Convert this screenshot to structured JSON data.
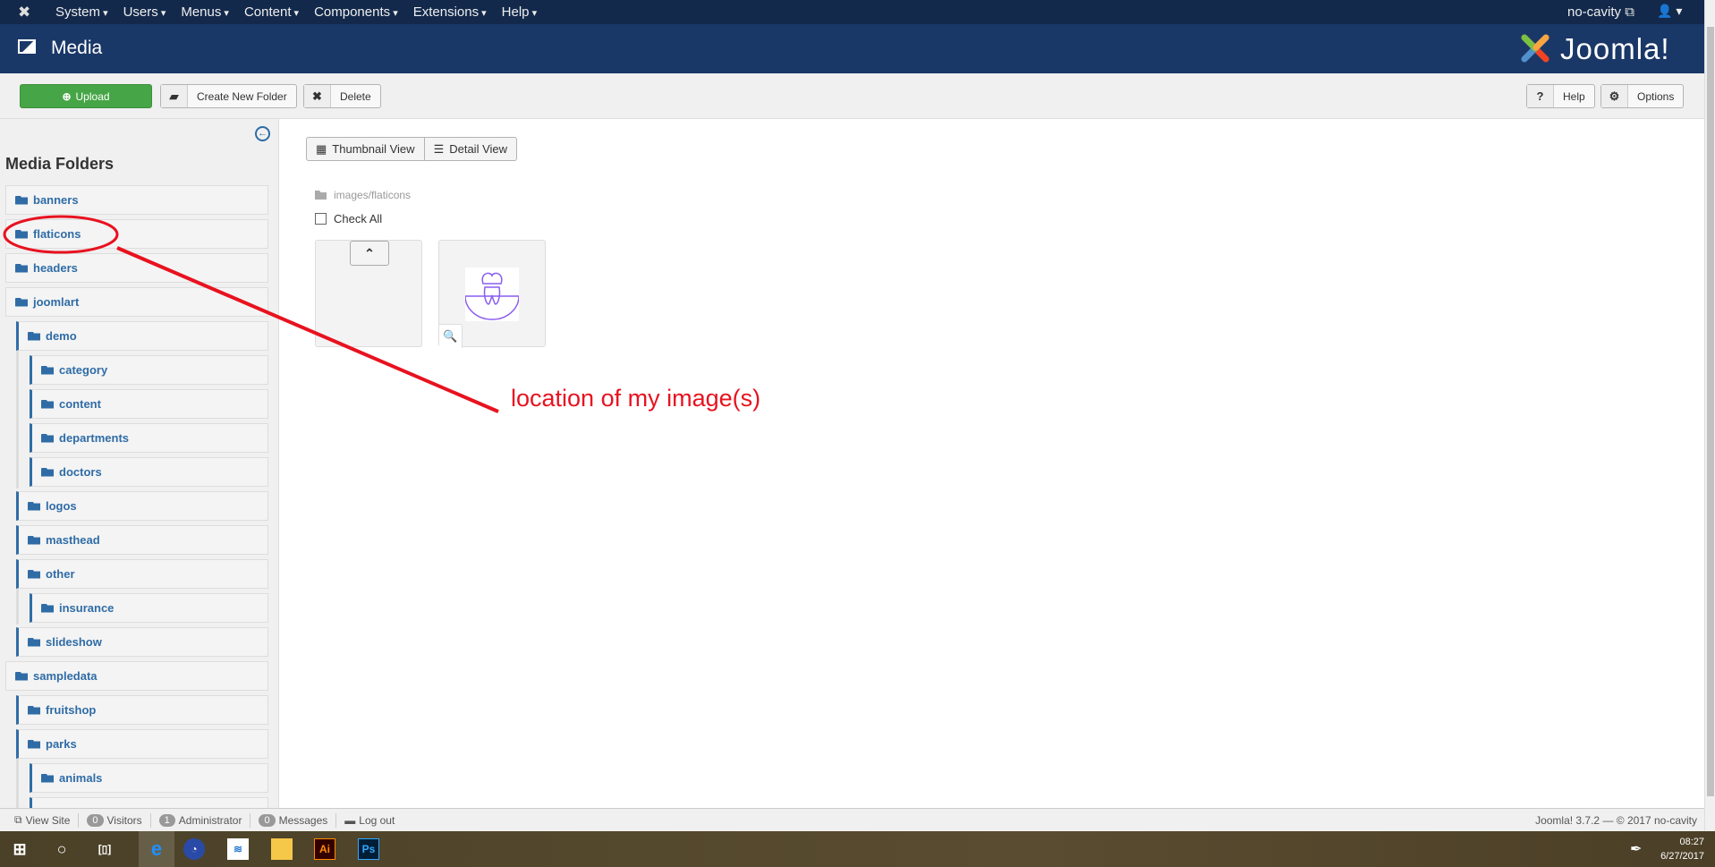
{
  "nav": {
    "menus": [
      "System",
      "Users",
      "Menus",
      "Content",
      "Components",
      "Extensions",
      "Help"
    ],
    "site": "no-cavity"
  },
  "header": {
    "title": "Media",
    "brand": "Joomla!"
  },
  "toolbar": {
    "upload": "Upload",
    "new_folder": "Create New Folder",
    "delete": "Delete",
    "help": "Help",
    "options": "Options"
  },
  "sidebar": {
    "title": "Media Folders",
    "folders": [
      {
        "label": "banners",
        "level": 0
      },
      {
        "label": "flaticons",
        "level": 0
      },
      {
        "label": "headers",
        "level": 0
      },
      {
        "label": "joomlart",
        "level": 0
      },
      {
        "label": "demo",
        "level": 1
      },
      {
        "label": "category",
        "level": 2
      },
      {
        "label": "content",
        "level": 2
      },
      {
        "label": "departments",
        "level": 2
      },
      {
        "label": "doctors",
        "level": 2
      },
      {
        "label": "logos",
        "level": 1
      },
      {
        "label": "masthead",
        "level": 1
      },
      {
        "label": "other",
        "level": 1
      },
      {
        "label": "insurance",
        "level": 2
      },
      {
        "label": "slideshow",
        "level": 1
      },
      {
        "label": "sampledata",
        "level": 0
      },
      {
        "label": "fruitshop",
        "level": 1
      },
      {
        "label": "parks",
        "level": 1
      },
      {
        "label": "animals",
        "level": 2
      },
      {
        "label": "",
        "level": 2
      }
    ]
  },
  "main": {
    "thumbnail_view": "Thumbnail View",
    "detail_view": "Detail View",
    "path": "images/flaticons",
    "check_all": "Check All"
  },
  "annotation": {
    "text": "location of my image(s)",
    "color": "#e8121f"
  },
  "status": {
    "view_site": "View Site",
    "visitors_count": "0",
    "visitors": "Visitors",
    "admin_count": "1",
    "admin": "Administrator",
    "messages_count": "0",
    "messages": "Messages",
    "logout": "Log out",
    "version": "Joomla! 3.7.2 — © 2017 no-cavity"
  },
  "taskbar": {
    "time": "08:27",
    "date": "6/27/2017"
  },
  "colors": {
    "nav": "#13294b",
    "header": "#1a3867",
    "upload": "#46a546",
    "link": "#2f6ca6"
  }
}
